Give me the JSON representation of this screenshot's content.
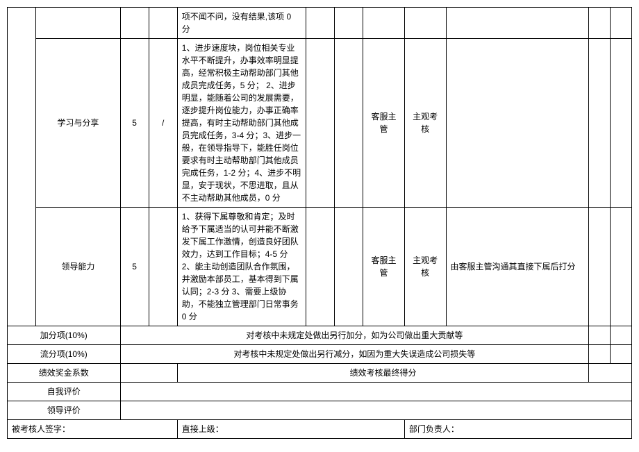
{
  "rows": {
    "r0_criteria": "项不闻不问，没有结果,该项 0 分",
    "r1_item": "学习与分享",
    "r1_weight": "5",
    "r1_slash": "/",
    "r1_criteria": "1、进步速度块，岗位相关专业水平不断提升，办事效率明显提高，经常积极主动帮助部门其他成员完成任务，5 分；\n2、进步明显，能随着公司的发展需要，逐步提升岗位能力，办事正确率提高，有时主动帮助部门其他成员完成任务，3-4 分；3、进步一般，在领导指导下，能胜任岗位要求有时主动帮助部门其他成员完成任务，1-2 分；4、进步不明显，安于现状，不思进取，且从不主动帮助其他成员，0 分",
    "r1_evaluator": "客服主管",
    "r1_method": "主观考核",
    "r2_item": "领导能力",
    "r2_weight": "5",
    "r2_criteria": "1、获得下属尊敬和肯定；及时给予下属适当的认可并能不断激发下属工作激情，创造良好团队效力，达到工作目标；4-5 分 2、能主动创造团队合作氛围，并激励本部员工，基本得到下属认同；2-3 分\n3、需要上级协助，不能独立管理部门日常事务 0 分",
    "r2_evaluator": "客服主管",
    "r2_method": "主观考核",
    "r2_note": "由客服主管沟通其直接下属后打分"
  },
  "footer": {
    "bonus_label": "加分项(10%)",
    "bonus_desc": "对考核中未规定处做出另行加分，如为公司做出重大贡献等",
    "deduct_label": "流分项(10%)",
    "deduct_desc": "对考核中未规定处做出另行减分，如因为重大失误造成公司损失等",
    "coef_label": "绩效奖金系数",
    "coef_desc": "绩效考核最终得分",
    "self_label": "自我评价",
    "leader_label": "领导评价",
    "sign_assessee": "被考核人签字：",
    "sign_supervisor": "直接上级：",
    "sign_dept": "部门负责人："
  }
}
